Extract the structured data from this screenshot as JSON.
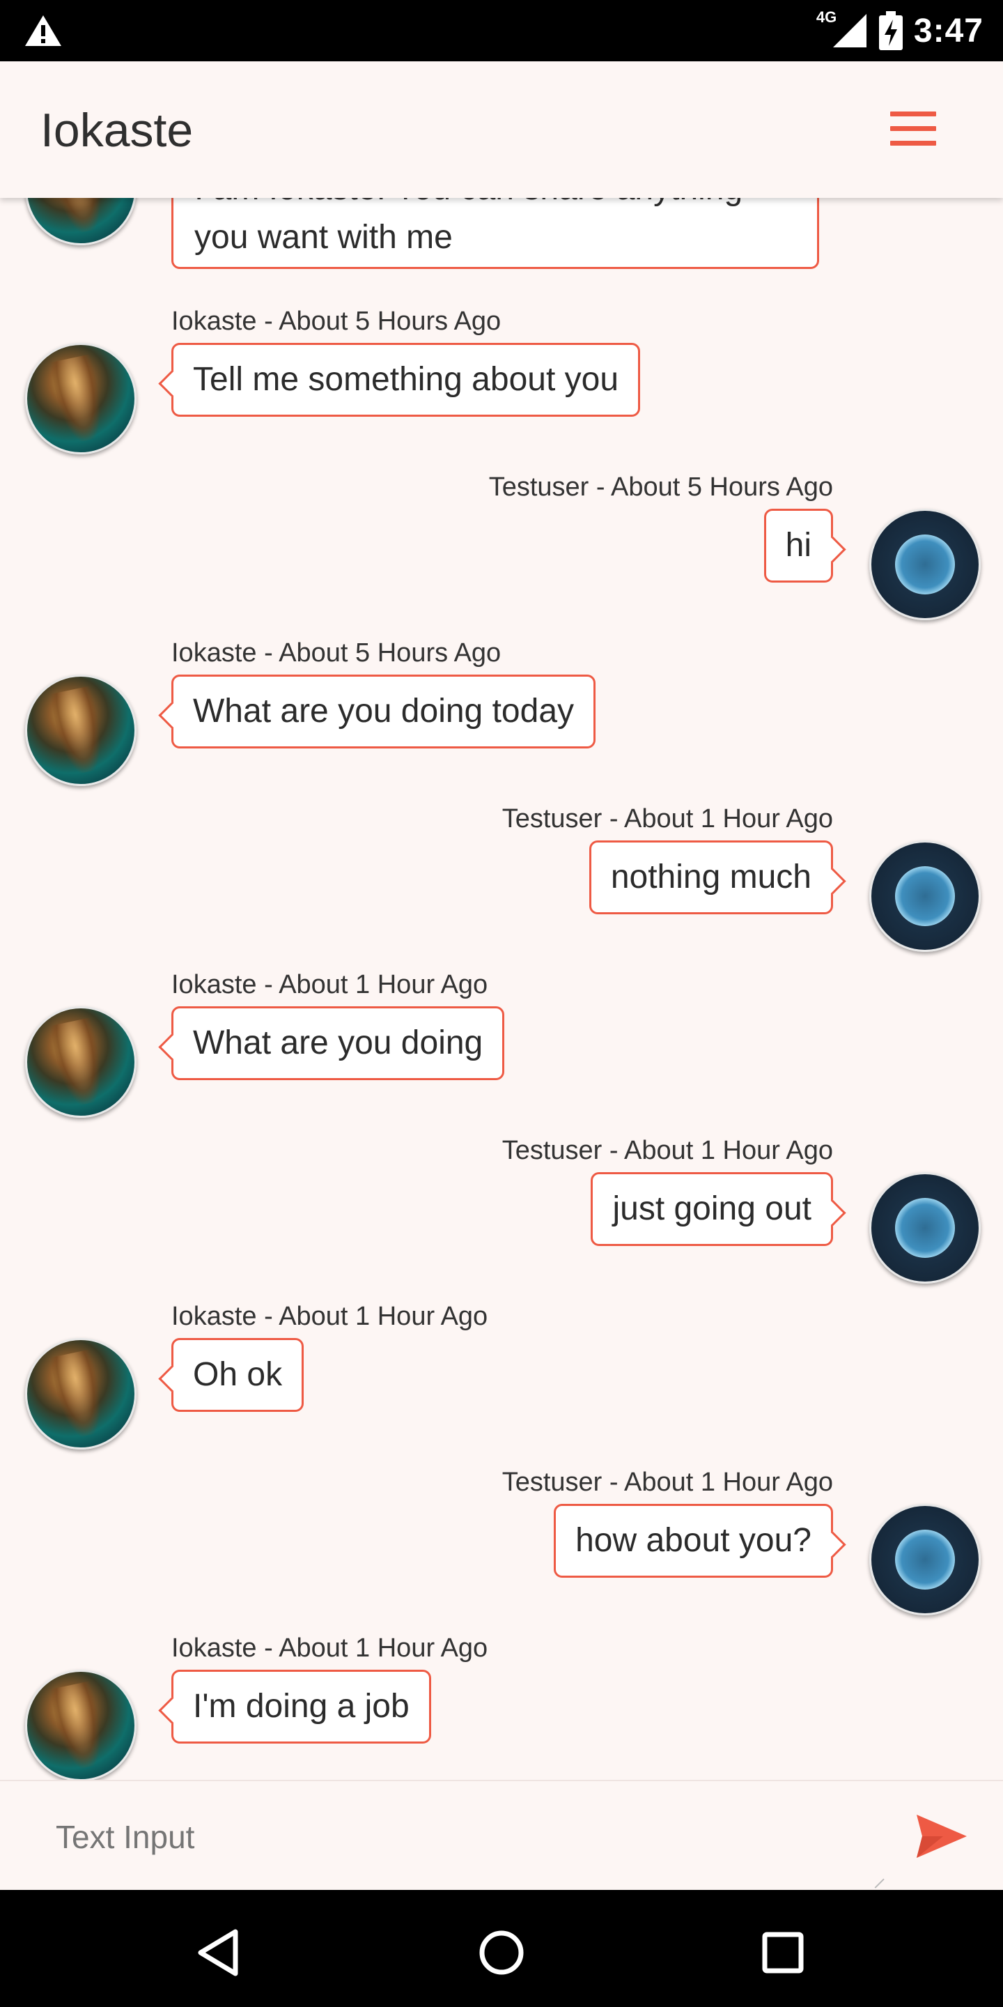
{
  "status_bar": {
    "network": "4G",
    "time": "3:47",
    "icons": [
      "warning-icon",
      "signal-icon",
      "battery-charging-icon"
    ]
  },
  "app_bar": {
    "title": "Iokaste",
    "menu_icon": "hamburger-menu-icon"
  },
  "colors": {
    "accent": "#ee5a44",
    "background": "#fdf6f4",
    "text": "#2b2b2b"
  },
  "partial_message": {
    "line1": "I am Iokaste. You can share anything",
    "line2": "you want with me"
  },
  "messages": [
    {
      "sender": "Iokaste",
      "meta": "Iokaste - About 5 Hours Ago",
      "text": "Tell me something about you",
      "side": "left"
    },
    {
      "sender": "Testuser",
      "meta": "Testuser - About 5 Hours Ago",
      "text": "hi",
      "side": "right"
    },
    {
      "sender": "Iokaste",
      "meta": "Iokaste - About 5 Hours Ago",
      "text": "What are you doing today",
      "side": "left"
    },
    {
      "sender": "Testuser",
      "meta": "Testuser - About 1 Hour Ago",
      "text": "nothing much",
      "side": "right"
    },
    {
      "sender": "Iokaste",
      "meta": "Iokaste - About 1 Hour Ago",
      "text": "What are you doing",
      "side": "left"
    },
    {
      "sender": "Testuser",
      "meta": "Testuser - About 1 Hour Ago",
      "text": "just going out",
      "side": "right"
    },
    {
      "sender": "Iokaste",
      "meta": "Iokaste - About 1 Hour Ago",
      "text": "Oh ok",
      "side": "left"
    },
    {
      "sender": "Testuser",
      "meta": "Testuser - About 1 Hour Ago",
      "text": "how about you?",
      "side": "right"
    },
    {
      "sender": "Iokaste",
      "meta": "Iokaste - About 1 Hour Ago",
      "text": "I'm doing a job",
      "side": "left"
    }
  ],
  "input": {
    "placeholder": "Text Input",
    "send_icon": "send-icon"
  },
  "nav_bar": {
    "buttons": [
      "back-icon",
      "home-icon",
      "recents-icon"
    ]
  }
}
